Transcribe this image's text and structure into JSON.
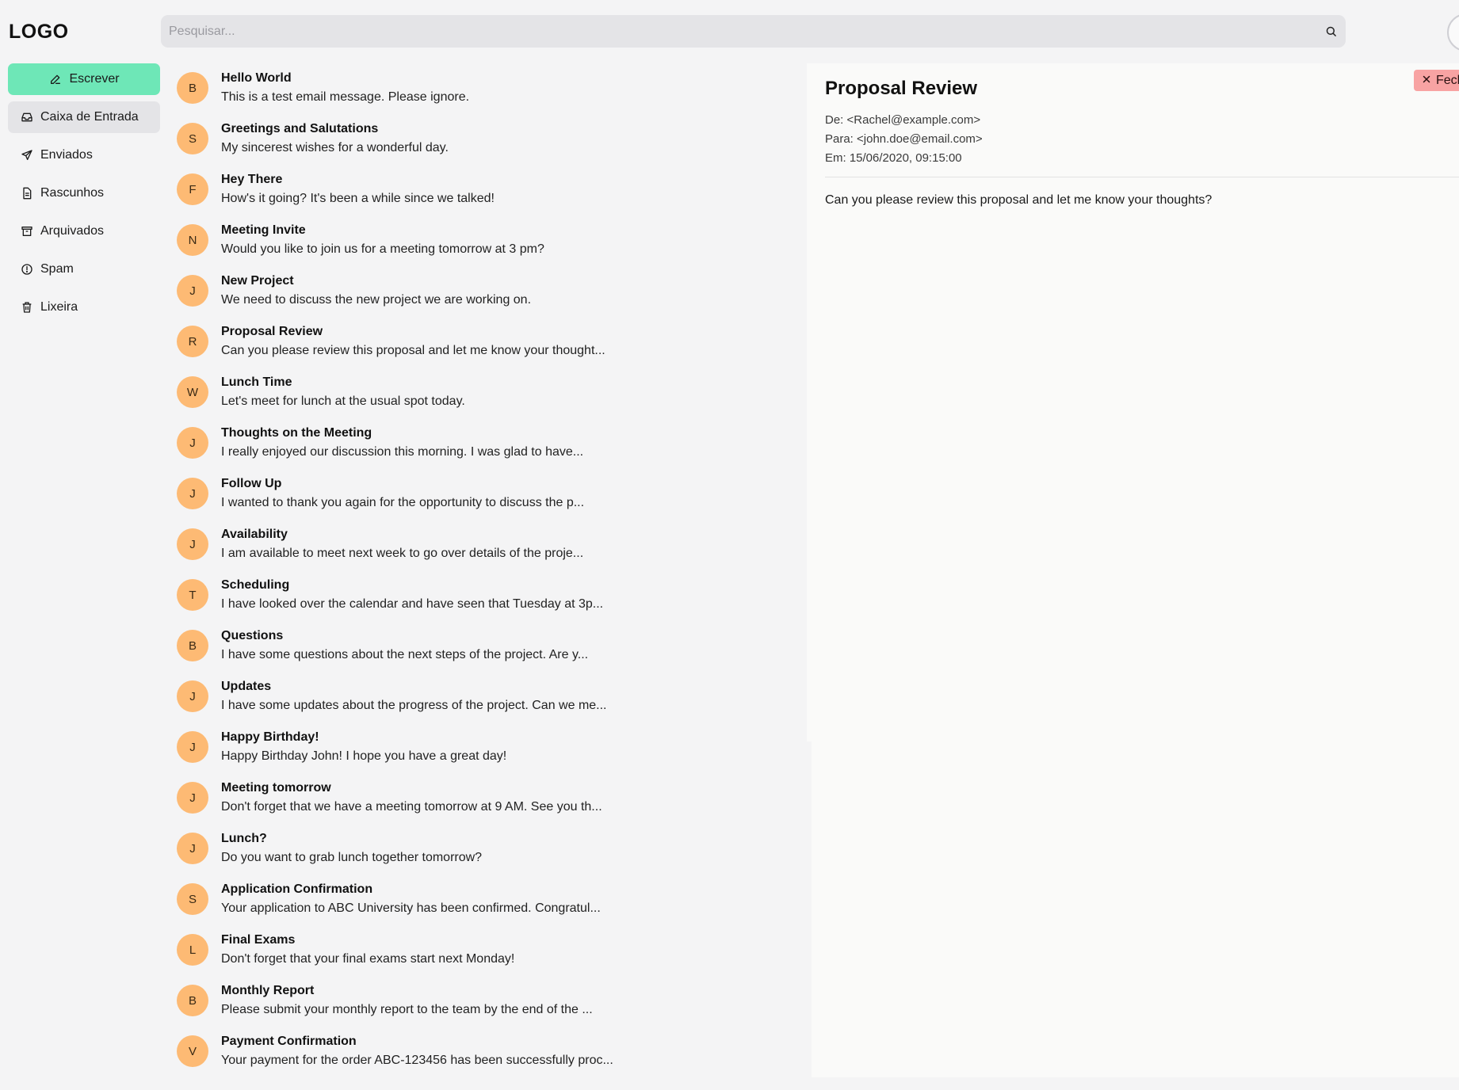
{
  "header": {
    "logo": "LOGO",
    "search_placeholder": "Pesquisar..."
  },
  "sidebar": {
    "compose_label": "Escrever",
    "items": [
      {
        "label": "Caixa de Entrada",
        "icon": "inbox-icon",
        "active": true
      },
      {
        "label": "Enviados",
        "icon": "send-icon",
        "active": false
      },
      {
        "label": "Rascunhos",
        "icon": "draft-icon",
        "active": false
      },
      {
        "label": "Arquivados",
        "icon": "archive-icon",
        "active": false
      },
      {
        "label": "Spam",
        "icon": "spam-icon",
        "active": false
      },
      {
        "label": "Lixeira",
        "icon": "trash-icon",
        "active": false
      }
    ]
  },
  "emails": [
    {
      "initial": "B",
      "subject": "Hello World",
      "snippet": "This is a test email message. Please ignore."
    },
    {
      "initial": "S",
      "subject": "Greetings and Salutations",
      "snippet": "My sincerest wishes for a wonderful day."
    },
    {
      "initial": "F",
      "subject": "Hey There",
      "snippet": "How's it going? It's been a while since we talked!"
    },
    {
      "initial": "N",
      "subject": "Meeting Invite",
      "snippet": "Would you like to join us for a meeting tomorrow at 3 pm?"
    },
    {
      "initial": "J",
      "subject": "New Project",
      "snippet": "We need to discuss the new project we are working on."
    },
    {
      "initial": "R",
      "subject": "Proposal Review",
      "snippet": "Can you please review this proposal and let me know your thought..."
    },
    {
      "initial": "W",
      "subject": "Lunch Time",
      "snippet": "Let's meet for lunch at the usual spot today."
    },
    {
      "initial": "J",
      "subject": "Thoughts on the Meeting",
      "snippet": "I really enjoyed our discussion this morning. I was glad to have..."
    },
    {
      "initial": "J",
      "subject": "Follow Up",
      "snippet": "I wanted to thank you again for the opportunity to discuss the p..."
    },
    {
      "initial": "J",
      "subject": "Availability",
      "snippet": "I am available to meet next week to go over details of the proje..."
    },
    {
      "initial": "T",
      "subject": "Scheduling",
      "snippet": "I have looked over the calendar and have seen that Tuesday at 3p..."
    },
    {
      "initial": "B",
      "subject": "Questions",
      "snippet": "I have some questions about the next steps of the project. Are y..."
    },
    {
      "initial": "J",
      "subject": "Updates",
      "snippet": "I have some updates about the progress of the project. Can we me..."
    },
    {
      "initial": "J",
      "subject": "Happy Birthday!",
      "snippet": "Happy Birthday John! I hope you have a great day!"
    },
    {
      "initial": "J",
      "subject": "Meeting tomorrow",
      "snippet": "Don't forget that we have a meeting tomorrow at 9 AM. See you th..."
    },
    {
      "initial": "J",
      "subject": "Lunch?",
      "snippet": "Do you want to grab lunch together tomorrow?"
    },
    {
      "initial": "S",
      "subject": "Application Confirmation",
      "snippet": "Your application to ABC University has been confirmed. Congratul..."
    },
    {
      "initial": "L",
      "subject": "Final Exams",
      "snippet": "Don't forget that your final exams start next Monday!"
    },
    {
      "initial": "B",
      "subject": "Monthly Report",
      "snippet": "Please submit your monthly report to the team by the end of the ..."
    },
    {
      "initial": "V",
      "subject": "Payment Confirmation",
      "snippet": "Your payment for the order ABC-123456 has been successfully proc..."
    }
  ],
  "detail": {
    "title": "Proposal Review",
    "from": "De: <Rachel@example.com>",
    "to": "Para: <john.doe@email.com>",
    "date": "Em: 15/06/2020, 09:15:00",
    "body": "Can you please review this proposal and let me know your thoughts?",
    "close_label": "Fech"
  },
  "colors": {
    "compose": "#6ee7b7",
    "avatar": "#fdba74",
    "close": "#f8a3a3",
    "active_nav": "#e4e4e7"
  }
}
